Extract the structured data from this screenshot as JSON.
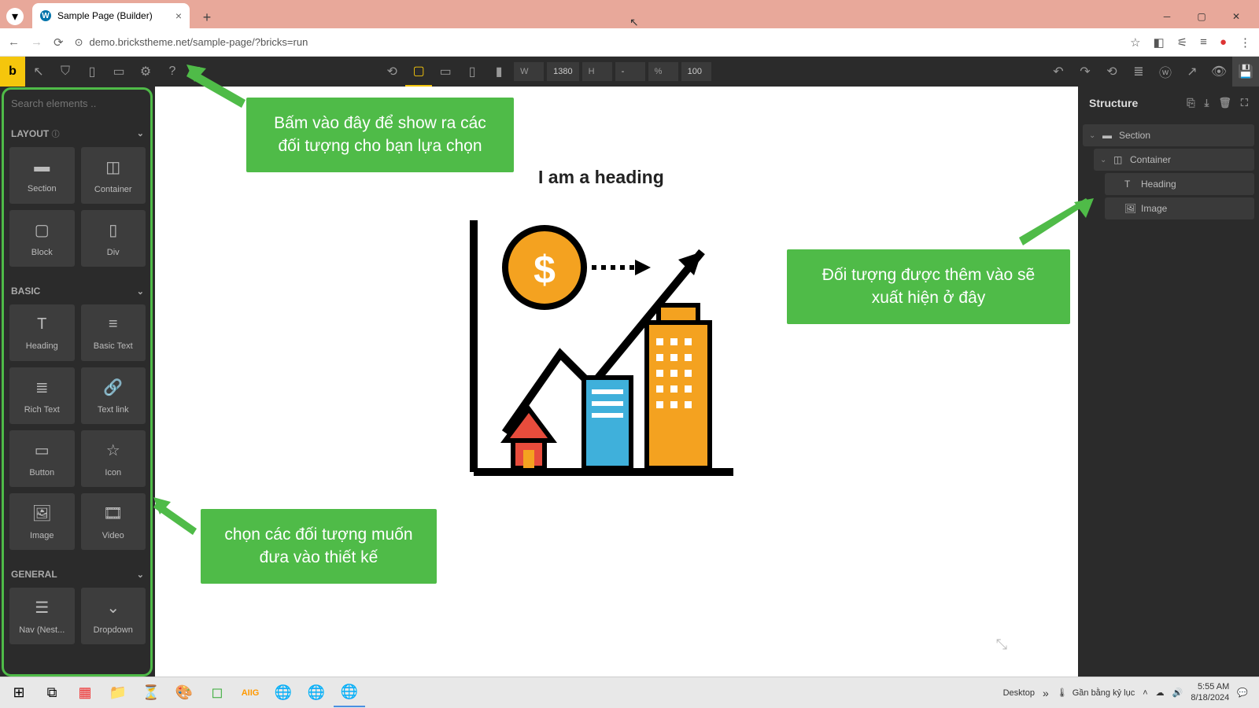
{
  "browser": {
    "tab_title": "Sample Page (Builder)",
    "url": "demo.brickstheme.net/sample-page/?bricks=run"
  },
  "toolbar": {
    "w_label": "W",
    "w_value": "1380",
    "h_label": "H",
    "h_value": "-",
    "percent_label": "%",
    "percent_value": "100"
  },
  "sidebar": {
    "search_placeholder": "Search elements ..",
    "categories": [
      {
        "name": "LAYOUT",
        "items": [
          {
            "label": "Section"
          },
          {
            "label": "Container"
          },
          {
            "label": "Block"
          },
          {
            "label": "Div"
          }
        ]
      },
      {
        "name": "BASIC",
        "items": [
          {
            "label": "Heading"
          },
          {
            "label": "Basic Text"
          },
          {
            "label": "Rich Text"
          },
          {
            "label": "Text link"
          },
          {
            "label": "Button"
          },
          {
            "label": "Icon"
          },
          {
            "label": "Image"
          },
          {
            "label": "Video"
          }
        ]
      },
      {
        "name": "GENERAL",
        "items": [
          {
            "label": "Nav (Nest..."
          },
          {
            "label": "Dropdown"
          }
        ]
      }
    ]
  },
  "canvas": {
    "heading": "I am a heading"
  },
  "structure": {
    "title": "Structure",
    "tree": {
      "section": "Section",
      "container": "Container",
      "heading": "Heading",
      "image": "Image"
    }
  },
  "callouts": {
    "top": "Bấm vào đây để show ra các đối tượng cho bạn lựa chọn",
    "right": "Đối tượng được thêm vào sẽ xuất hiện ở đây",
    "bottom": "chọn các đối tượng muốn đưa vào thiết kế"
  },
  "taskbar": {
    "desktop": "Desktop",
    "keyboard": "Gần bằng kỷ lục",
    "time": "5:55 AM",
    "date": "8/18/2024"
  }
}
